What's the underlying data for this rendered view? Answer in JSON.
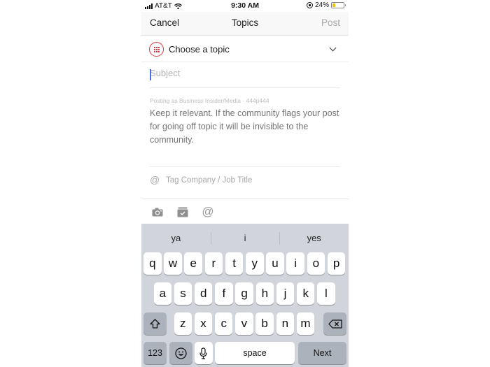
{
  "status_bar": {
    "carrier": "AT&T",
    "time": "9:30 AM",
    "battery_percent_label": "24%",
    "battery_level": 0.24,
    "battery_color": "#f4c20d"
  },
  "nav": {
    "cancel_label": "Cancel",
    "title": "Topics",
    "post_label": "Post"
  },
  "topic": {
    "label": "Choose a topic",
    "icon": "grid-icon",
    "accent_color": "#e0383e"
  },
  "subject": {
    "value": "",
    "placeholder": "Subject"
  },
  "posting_as": "Posting as Business Insider/Media  ·  444p444",
  "body": {
    "placeholder": "Keep it relevant. If the community flags your post for going off topic it will be invisible to the community."
  },
  "tag": {
    "icon": "at-icon",
    "label": "Tag Company / Job Title"
  },
  "toolbar": {
    "icons": [
      "camera-icon",
      "inbox-check-icon",
      "at-icon"
    ],
    "at_glyph": "@"
  },
  "keyboard": {
    "suggestions": [
      "ya",
      "i",
      "yes"
    ],
    "row1": [
      "q",
      "w",
      "e",
      "r",
      "t",
      "y",
      "u",
      "i",
      "o",
      "p"
    ],
    "row2": [
      "a",
      "s",
      "d",
      "f",
      "g",
      "h",
      "j",
      "k",
      "l"
    ],
    "row3": [
      "z",
      "x",
      "c",
      "v",
      "b",
      "n",
      "m"
    ],
    "numbers_label": "123",
    "space_label": "space",
    "return_label": "Next"
  }
}
